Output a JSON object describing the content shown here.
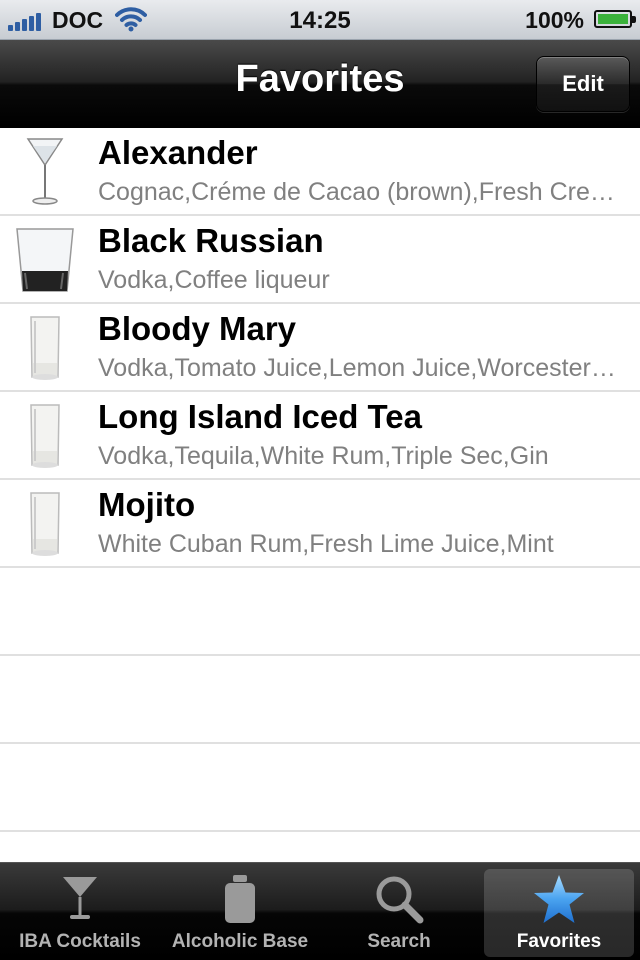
{
  "status_bar": {
    "carrier": "DOC",
    "time": "14:25",
    "battery_percent": "100%",
    "battery_level": 1.0,
    "signal_bars": 5
  },
  "nav": {
    "title": "Favorites",
    "edit_label": "Edit"
  },
  "favorites": [
    {
      "name": "Alexander",
      "ingredients": "Cognac,Créme de Cacao (brown),Fresh Cream",
      "glass_icon": "cocktail-glass-icon"
    },
    {
      "name": "Black Russian",
      "ingredients": "Vodka,Coffee liqueur",
      "glass_icon": "old-fashioned-glass-icon"
    },
    {
      "name": "Bloody Mary",
      "ingredients": "Vodka,Tomato Juice,Lemon Juice,Worcestershire Sauce",
      "glass_icon": "highball-glass-icon"
    },
    {
      "name": "Long Island Iced Tea",
      "ingredients": "Vodka,Tequila,White Rum,Triple Sec,Gin",
      "glass_icon": "highball-glass-icon"
    },
    {
      "name": "Mojito",
      "ingredients": "White Cuban Rum,Fresh Lime Juice,Mint",
      "glass_icon": "highball-glass-icon"
    }
  ],
  "tabs": [
    {
      "label": "IBA Cocktails",
      "icon": "cocktail-glass-icon",
      "selected": false
    },
    {
      "label": "Alcoholic Base",
      "icon": "bottle-icon",
      "selected": false
    },
    {
      "label": "Search",
      "icon": "magnifier-icon",
      "selected": false
    },
    {
      "label": "Favorites",
      "icon": "star-icon",
      "selected": true
    }
  ],
  "colors": {
    "tab_star": "#4aa3f0",
    "subtitle_gray": "#808080",
    "battery_green": "#3bb23b"
  }
}
